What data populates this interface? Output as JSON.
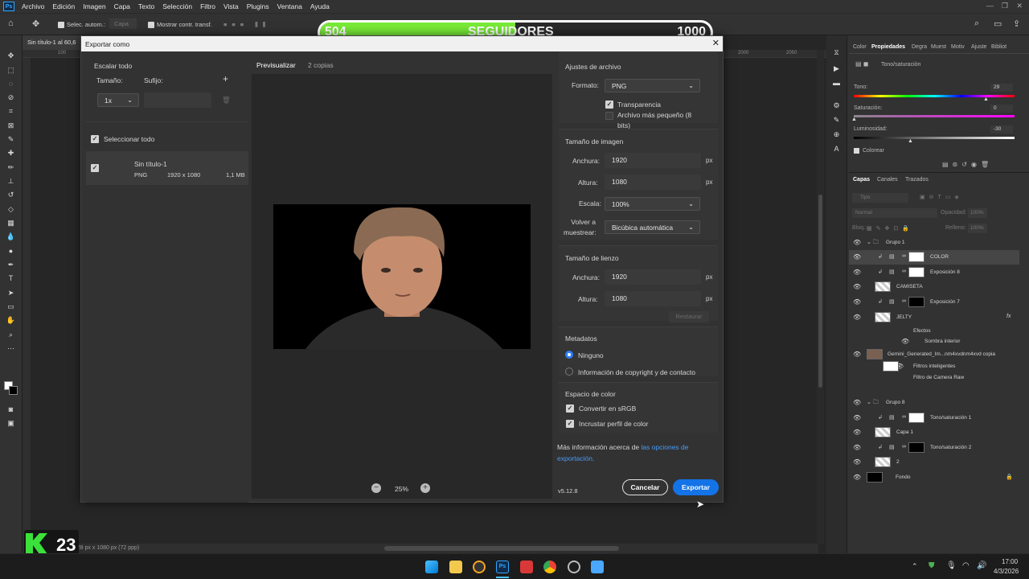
{
  "menu": {
    "app_icon": "Ps",
    "items": [
      "Archivo",
      "Edición",
      "Imagen",
      "Capa",
      "Texto",
      "Selección",
      "Filtro",
      "Vista",
      "Plugins",
      "Ventana",
      "Ayuda"
    ]
  },
  "options": {
    "auto_select": "Selec. autom.:",
    "auto_select_value": "Capa",
    "show_transform": "Mostrar contr. transf."
  },
  "banner": {
    "left": "504",
    "center": "SEGUIDORES",
    "right": "1000",
    "fill_fraction": 0.5,
    "fill_color": "#79ea38"
  },
  "document": {
    "tab_title": "Sin título-1 al 60,6",
    "status": "1928 px x 1080 px (72 ppp)",
    "ruler_marks": [
      "100",
      "2000",
      "2050"
    ]
  },
  "overlay_logo": {
    "text": "K23"
  },
  "dialog": {
    "title": "Exportar como",
    "close": "✕",
    "left": {
      "scale_all": "Escalar todo",
      "size_label": "Tamaño:",
      "suffix_label": "Sufijo:",
      "add": "+",
      "scale_value": "1x",
      "select_all": "Seleccionar todo",
      "asset": {
        "name": "Sin título-1",
        "format": "PNG",
        "dimensions": "1920 x 1080",
        "size": "1,1 MB"
      }
    },
    "preview": {
      "tab_active": "Previsualizar",
      "tab_copies": "2 copias",
      "zoom": "25%",
      "zoom_out": "−",
      "zoom_in": "+"
    },
    "right": {
      "file_settings": "Ajustes de archivo",
      "format_label": "Formato:",
      "format_value": "PNG",
      "transparency": "Transparencia",
      "smaller_file": "Archivo más pequeño (8 bits)",
      "image_size": "Tamaño de imagen",
      "width_label": "Anchura:",
      "width_value": "1920",
      "height_label": "Altura:",
      "height_value": "1080",
      "unit": "px",
      "scale_label": "Escala:",
      "scale_value": "100%",
      "resample_label": "Volver a muestrear:",
      "resample_value": "Bicúbica automática",
      "canvas_size": "Tamaño de lienzo",
      "canvas_width": "1920",
      "canvas_height": "1080",
      "restore": "Restaurar",
      "metadata": "Metadatos",
      "meta_none": "Ninguno",
      "meta_copyright": "Información de copyright y de contacto",
      "color_space": "Espacio de color",
      "convert_srgb": "Convertir en sRGB",
      "embed_profile": "Incrustar perfil de color",
      "more_info": "Más información acerca de ",
      "more_info_link": "las opciones de exportación.",
      "version": "v5.12.8",
      "cancel": "Cancelar",
      "export": "Exportar"
    }
  },
  "panel": {
    "tabs": [
      "Color",
      "Propiedades",
      "Degra",
      "Muest",
      "Motiv",
      "Ajuste",
      "Bibliot"
    ],
    "adjustment_title": "Tono/saturación",
    "tone_label": "Tono:",
    "tone_value": "29",
    "sat_label": "Saturación:",
    "sat_value": "0",
    "lum_label": "Luminosidad:",
    "lum_value": "-30",
    "colorize": "Colorear",
    "layer_tabs": [
      "Capas",
      "Canales",
      "Trazados"
    ],
    "search_placeholder": "Tipo",
    "blend_mode": "Normal",
    "opacity_label": "Opacidad:",
    "opacity_value": "100%",
    "fill_label": "Relleno:",
    "fill_value": "100%",
    "lock_label": "Bloq.:",
    "layers": [
      {
        "name": "Grupo 1",
        "type": "group",
        "indent": 0
      },
      {
        "name": "COLOR",
        "type": "adj",
        "indent": 1
      },
      {
        "name": "Exposición 8",
        "type": "adj",
        "indent": 1
      },
      {
        "name": "CAMISETA",
        "type": "pixel",
        "indent": 1
      },
      {
        "name": "Exposición 7",
        "type": "adj",
        "indent": 1
      },
      {
        "name": "JELTY",
        "type": "pixel",
        "indent": 1
      },
      {
        "name": "Efectos",
        "type": "sub",
        "indent": 2
      },
      {
        "name": "Sombra interior",
        "type": "sub",
        "indent": 3
      },
      {
        "name": "Gemini_Generated_Im...nm4xvdnm4xvd copia",
        "type": "smart",
        "indent": 0
      },
      {
        "name": "Filtros inteligentes",
        "type": "sub",
        "indent": 2
      },
      {
        "name": "Filtro de Camera Raw",
        "type": "sub",
        "indent": 2
      },
      {
        "name": "Grupo 8",
        "type": "group",
        "indent": 0
      },
      {
        "name": "Tono/saturación 1",
        "type": "adj",
        "indent": 1
      },
      {
        "name": "Capa 1",
        "type": "pixel",
        "indent": 1
      },
      {
        "name": "Tono/saturación 2",
        "type": "adj",
        "indent": 1
      },
      {
        "name": "2",
        "type": "pixel",
        "indent": 1
      },
      {
        "name": "Fondo",
        "type": "bg",
        "indent": 0
      }
    ]
  },
  "taskbar": {
    "time": "17:00",
    "date": "4/3/2026"
  }
}
